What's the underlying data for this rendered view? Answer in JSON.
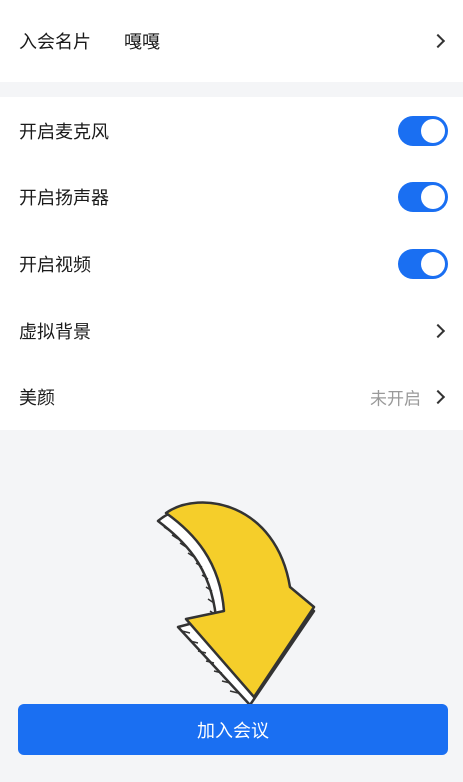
{
  "profile": {
    "name_label": "入会名片",
    "name_value": "嘎嘎"
  },
  "settings": {
    "mic_label": "开启麦克风",
    "mic_on": true,
    "speaker_label": "开启扬声器",
    "speaker_on": true,
    "video_label": "开启视频",
    "video_on": true,
    "virtual_bg_label": "虚拟背景",
    "beauty_label": "美颜",
    "beauty_status": "未开启"
  },
  "actions": {
    "join_label": "加入会议"
  },
  "colors": {
    "accent": "#1a6ff2",
    "arrow_fill": "#f5ce2a"
  }
}
